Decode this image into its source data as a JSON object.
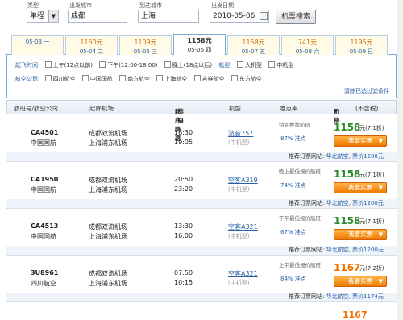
{
  "search": {
    "type_label": "类型",
    "type_value": "单程",
    "from_label": "出发城市",
    "from_value": "成都",
    "to_label": "到达城市",
    "to_value": "上海",
    "date_label": "出发日期",
    "date_value": "2010-05-06",
    "button": "机票搜索"
  },
  "date_tabs": [
    {
      "price": "",
      "date": "05-03 一"
    },
    {
      "price": "1150元",
      "date": "05-04 二"
    },
    {
      "price": "1109元",
      "date": "05-05 三"
    },
    {
      "price": "1158元",
      "date": "05-06 四"
    },
    {
      "price": "1158元",
      "date": "05-07 五"
    },
    {
      "price": "741元",
      "date": "05-08 六"
    },
    {
      "price": "1195元",
      "date": "05-09 日"
    }
  ],
  "filters": {
    "time_label": "起飞时间:",
    "time_options": [
      "上午(12点以前)",
      "下午(12:00-18:00)",
      "晚上(18点以后)"
    ],
    "model_label": "机型:",
    "model_options": [
      "大机型",
      "中机型"
    ],
    "airline_label": "航空公司:",
    "airline_options": [
      "四川航空",
      "中国国航",
      "南方航空",
      "上海航空",
      "吉祥航空",
      "东方航空"
    ],
    "clear_link": "清除已选过滤条件"
  },
  "table_header": {
    "flight": "航班号/航空公司",
    "airports": "起降机场",
    "times": "起飞/降落",
    "sort": "(排序)",
    "model": "机型",
    "ontime": "准点率",
    "price": "价格",
    "tax": "(不含税)"
  },
  "flights": [
    {
      "no": "CA4501",
      "airline": "中国国航",
      "dep_airport": "成都双流机场",
      "arr_airport": "上海浦东机场",
      "dep_time": "16:30",
      "arr_time": "19:05",
      "model": "波音757",
      "size": "(中机型)",
      "tag": "特别推荐航班",
      "ontime": "87% 准点",
      "price": "1158",
      "price_unit": "元",
      "discount": "(7.1折)",
      "book": "我要买票",
      "rec_label": "推荐订票网站:",
      "rec_site": "华北航空, 票价1200元"
    },
    {
      "no": "CA1950",
      "airline": "中国国航",
      "dep_airport": "成都双流机场",
      "arr_airport": "上海浦东机场",
      "dep_time": "20:50",
      "arr_time": "23:20",
      "model": "空客A319",
      "size": "(中机型)",
      "tag": "晚上最低报价航班",
      "ontime": "74% 准点",
      "price": "1158",
      "price_unit": "元",
      "discount": "(7.1折)",
      "book": "我要买票",
      "rec_label": "推荐订票网站:",
      "rec_site": "华北航空, 票价1200元"
    },
    {
      "no": "CA4513",
      "airline": "中国国航",
      "dep_airport": "成都双流机场",
      "arr_airport": "上海浦东机场",
      "dep_time": "13:30",
      "arr_time": "16:00",
      "model": "空客A321",
      "size": "(中机型)",
      "tag": "下午最低报价航班",
      "ontime": "67% 准点",
      "price": "1158",
      "price_unit": "元",
      "discount": "(7.1折)",
      "book": "我要买票",
      "rec_label": "推荐订票网站:",
      "rec_site": "华北航空, 票价1200元"
    },
    {
      "no": "3U8961",
      "airline": "四川航空",
      "dep_airport": "成都双流机场",
      "arr_airport": "上海浦东机场",
      "dep_time": "07:50",
      "arr_time": "10:15",
      "model": "空客A321",
      "size": "(中机型)",
      "tag": "上午最低报价航班",
      "ontime": "84% 准点",
      "price": "1167",
      "price_unit": "元",
      "discount": "(7.2折)",
      "book": "我要买票",
      "rec_label": "推荐订票网站:",
      "rec_site": "华北航空, 票价1174元"
    }
  ],
  "partial_price": "1167",
  "colors": {
    "accent_blue": "#2a5fa6",
    "price_green": "#2a8a2a",
    "price_orange": "#f07000",
    "button_orange": "#f07a00"
  }
}
